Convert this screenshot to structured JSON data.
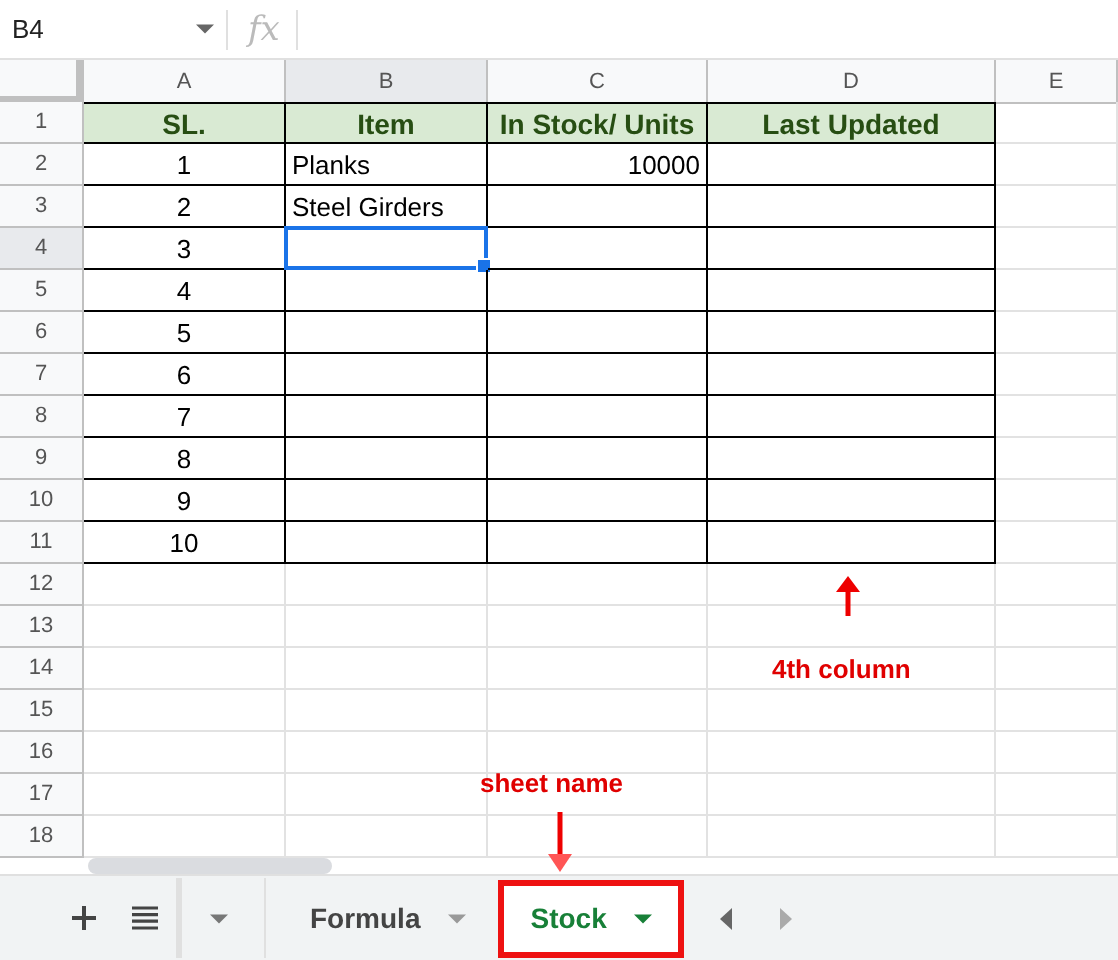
{
  "name_box": "B4",
  "formula_label": "fx",
  "columns": [
    {
      "letter": "A",
      "in_table": true,
      "selected": false
    },
    {
      "letter": "B",
      "in_table": true,
      "selected": true
    },
    {
      "letter": "C",
      "in_table": true,
      "selected": false
    },
    {
      "letter": "D",
      "in_table": true,
      "selected": false
    },
    {
      "letter": "E",
      "in_table": false,
      "selected": false
    }
  ],
  "rows": [
    {
      "number": "1",
      "kind": "header",
      "cells": {
        "A": "SL.",
        "B": "Item",
        "C": "In Stock/ Units",
        "D": "Last Updated"
      }
    },
    {
      "number": "2",
      "kind": "data",
      "cells": {
        "A": "1",
        "B": "Planks",
        "C": "10000"
      }
    },
    {
      "number": "3",
      "kind": "data",
      "cells": {
        "A": "2",
        "B": "Steel Girders"
      }
    },
    {
      "number": "4",
      "kind": "data",
      "selected": true,
      "cells": {
        "A": "3"
      }
    },
    {
      "number": "5",
      "kind": "data",
      "cells": {
        "A": "4"
      }
    },
    {
      "number": "6",
      "kind": "data",
      "cells": {
        "A": "5"
      }
    },
    {
      "number": "7",
      "kind": "data",
      "cells": {
        "A": "6"
      }
    },
    {
      "number": "8",
      "kind": "data",
      "cells": {
        "A": "7"
      }
    },
    {
      "number": "9",
      "kind": "data",
      "cells": {
        "A": "8"
      }
    },
    {
      "number": "10",
      "kind": "data",
      "cells": {
        "A": "9"
      }
    },
    {
      "number": "11",
      "kind": "data",
      "cells": {
        "A": "10"
      }
    },
    {
      "number": "12",
      "kind": "blank",
      "cells": {}
    },
    {
      "number": "13",
      "kind": "blank",
      "cells": {}
    },
    {
      "number": "14",
      "kind": "blank",
      "cells": {}
    },
    {
      "number": "15",
      "kind": "blank",
      "cells": {}
    },
    {
      "number": "16",
      "kind": "blank",
      "cells": {}
    },
    {
      "number": "17",
      "kind": "blank",
      "cells": {}
    },
    {
      "number": "18",
      "kind": "blank",
      "cells": {}
    }
  ],
  "tabs": [
    {
      "label": "Formula",
      "selected": false
    },
    {
      "label": "Stock",
      "selected": true
    }
  ],
  "annotations": [
    {
      "kind": "column",
      "text": "4th column"
    },
    {
      "kind": "sheet",
      "text": "sheet name"
    }
  ]
}
